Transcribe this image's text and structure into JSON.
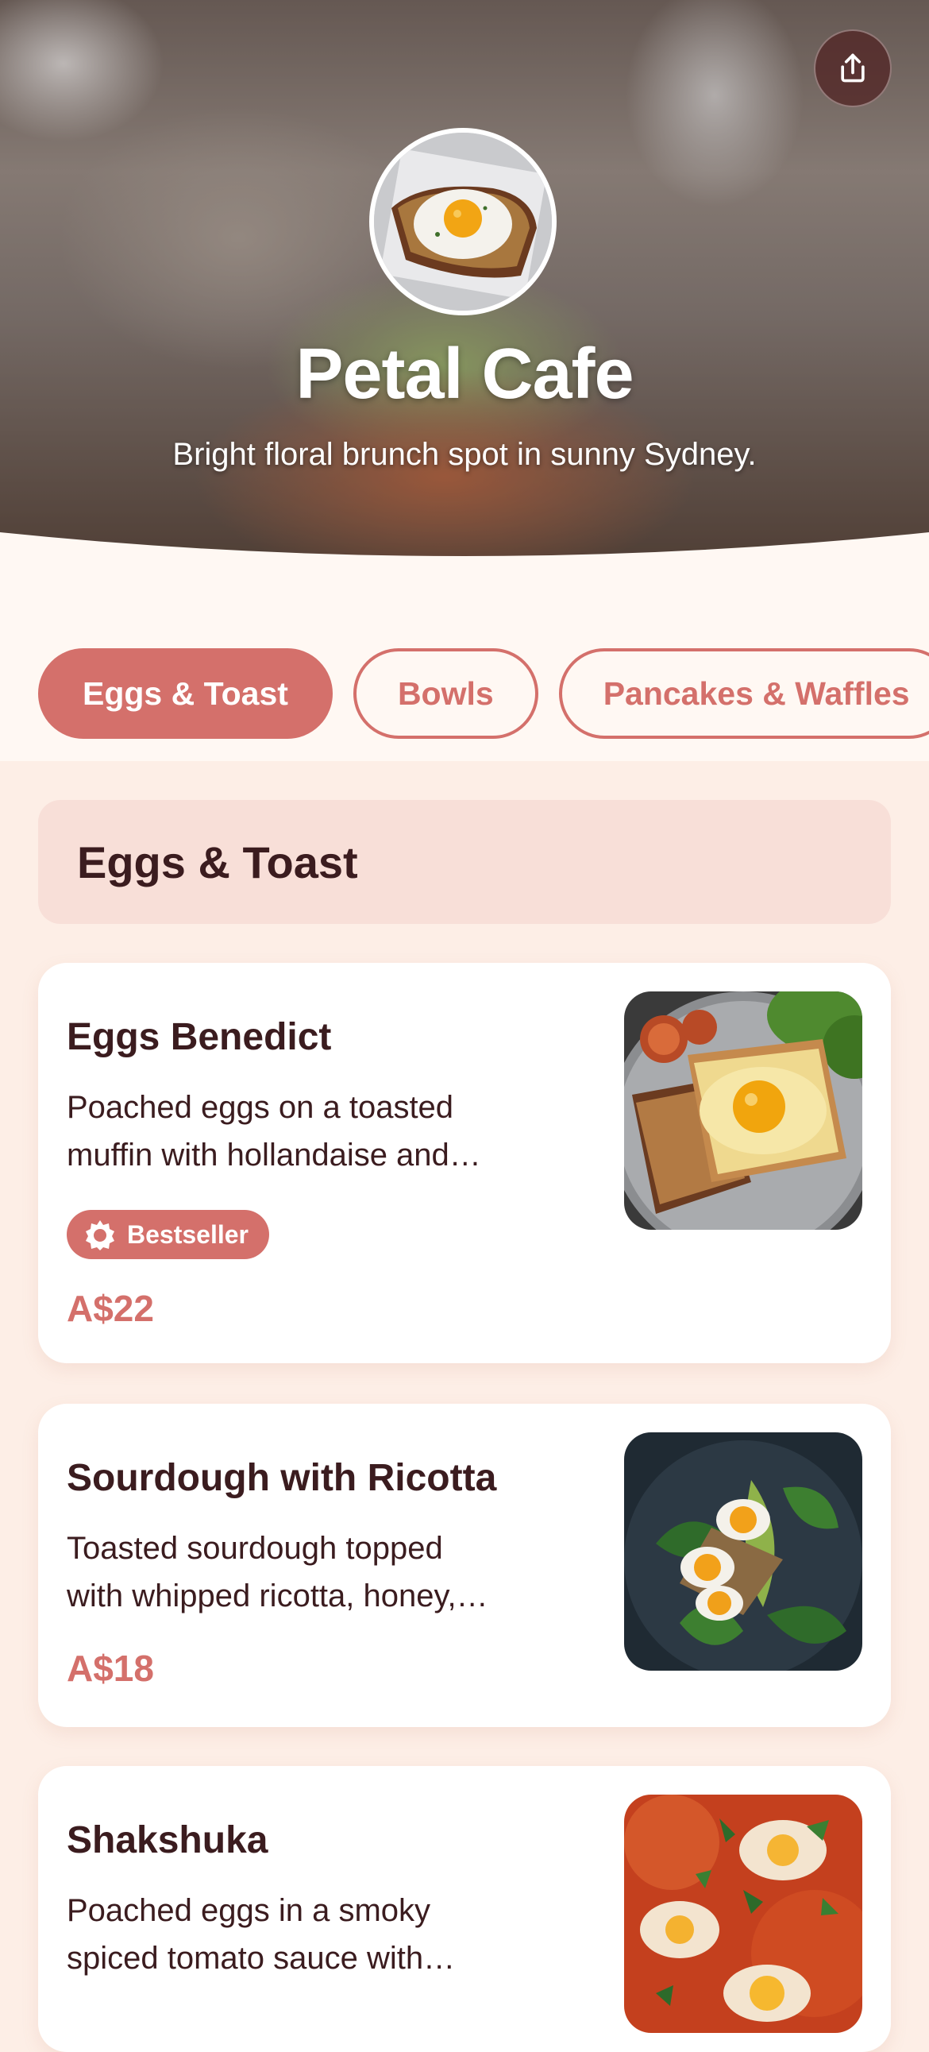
{
  "header": {
    "cafe_name": "Petal Cafe",
    "tagline": "Bright floral brunch spot in sunny Sydney.",
    "share_icon": "share-icon",
    "avatar_image": "fried egg on toast photo"
  },
  "tabs": [
    {
      "label": "Eggs & Toast",
      "active": true
    },
    {
      "label": "Bowls",
      "active": false
    },
    {
      "label": "Pancakes & Waffles",
      "active": false
    }
  ],
  "section": {
    "title": "Eggs & Toast"
  },
  "items": [
    {
      "name": "Eggs Benedict",
      "description_line1": "Poached eggs on a toasted",
      "description_line2": "muffin with hollandaise and…",
      "badge": "Bestseller",
      "badge_icon": "badge-star-icon",
      "price": "A$22",
      "image": "fried egg on toast photo"
    },
    {
      "name": "Sourdough with Ricotta",
      "description_line1": "Toasted sourdough topped",
      "description_line2": "with whipped ricotta, honey,…",
      "price": "A$18",
      "image": "boiled eggs avocado spinach photo"
    },
    {
      "name": "Shakshuka",
      "description_line1": "Poached eggs in a smoky",
      "description_line2": "spiced tomato sauce with…",
      "image": "shakshuka pan photo"
    }
  ],
  "colors": {
    "accent": "#d4706b",
    "text": "#3b1c1f",
    "page_background": "#fdeee6",
    "section_header": "#f8dfd8",
    "card": "#ffffff"
  }
}
